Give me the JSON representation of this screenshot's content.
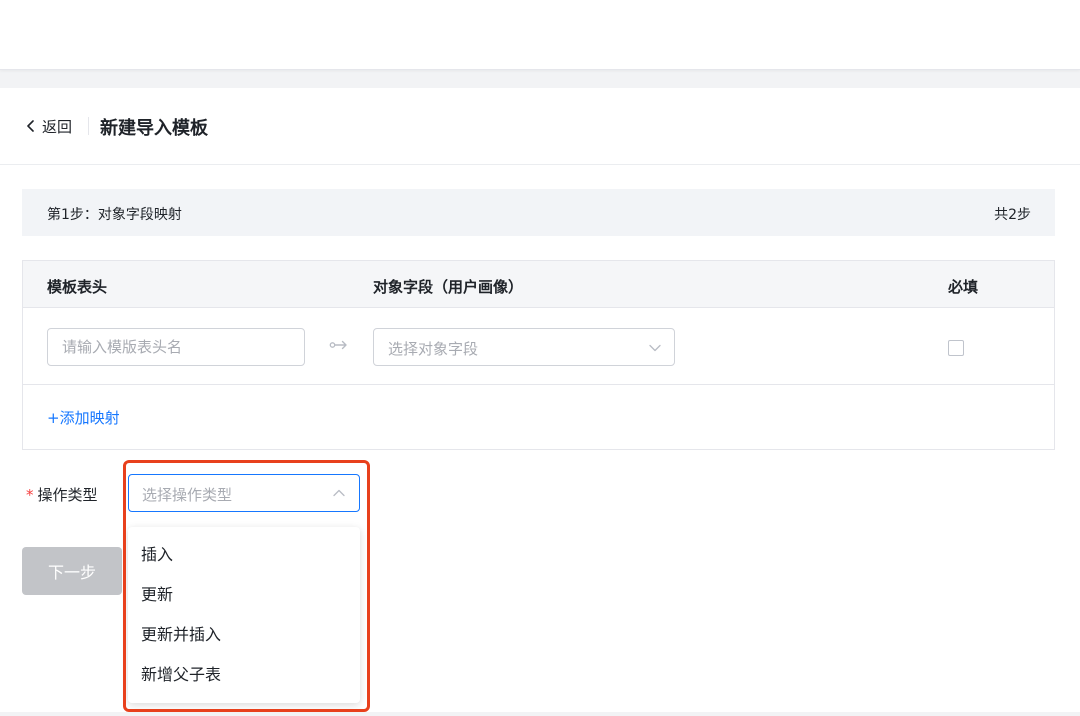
{
  "header": {
    "back_label": "返回",
    "title": "新建导入模板"
  },
  "step": {
    "label": "第1步：对象字段映射",
    "total": "共2步"
  },
  "mapping_table": {
    "columns": [
      "模板表头",
      "对象字段（用户画像）",
      "必填"
    ],
    "row": {
      "header_input_placeholder": "请输入模版表头名",
      "header_input_value": "",
      "field_select_placeholder": "选择对象字段",
      "required_checked": false
    },
    "add_label": "+添加映射"
  },
  "operation": {
    "required_mark": "*",
    "label": "操作类型",
    "placeholder": "选择操作类型",
    "options": [
      "插入",
      "更新",
      "更新并插入",
      "新增父子表"
    ],
    "dropdown_open": true
  },
  "next_button_label": "下一步",
  "colors": {
    "primary": "#1677ff",
    "required": "#f53f3f",
    "highlight": "#e8401c",
    "disabled_button": "#c2c4c8"
  },
  "icons": [
    "chevron-left-icon",
    "mapping-arrow-icon",
    "chevron-down-icon",
    "chevron-up-icon"
  ]
}
